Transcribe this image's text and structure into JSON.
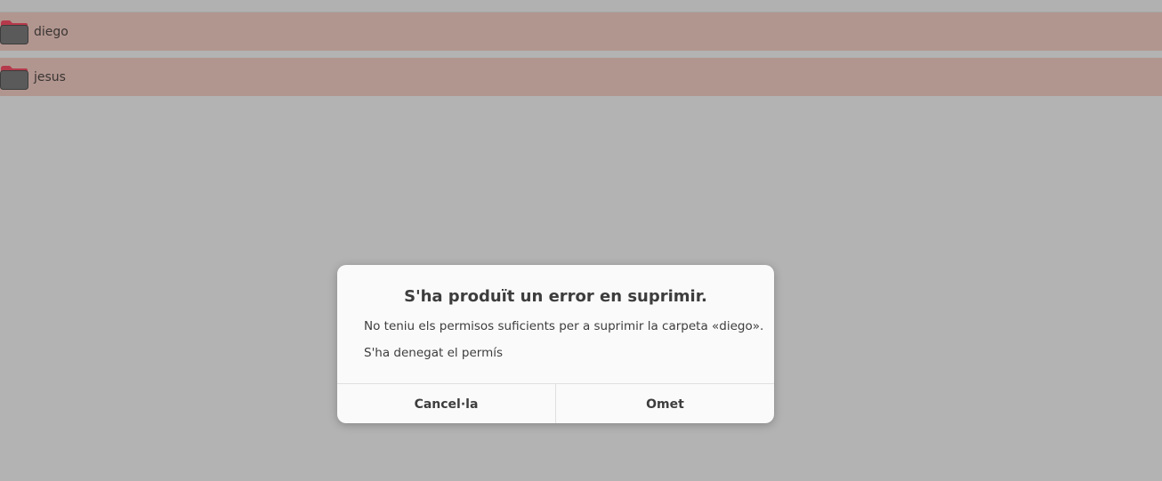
{
  "files": [
    {
      "name": "diego",
      "icon": "folder-icon"
    },
    {
      "name": "jesus",
      "icon": "folder-icon"
    }
  ],
  "dialog": {
    "title": "S'ha produït un error en suprimir.",
    "message": "No teniu els permisos suficients per a suprimir la carpeta «diego».",
    "detail": "S'ha denegat el permís",
    "cancel_label": "Cancel·la",
    "skip_label": "Omet"
  },
  "colors": {
    "selected_row": "#b1968f",
    "background": "#b3b3b3",
    "dialog_bg": "#fafafa",
    "folder_tab": "#b5394b",
    "folder_body": "#5a5a5a"
  }
}
